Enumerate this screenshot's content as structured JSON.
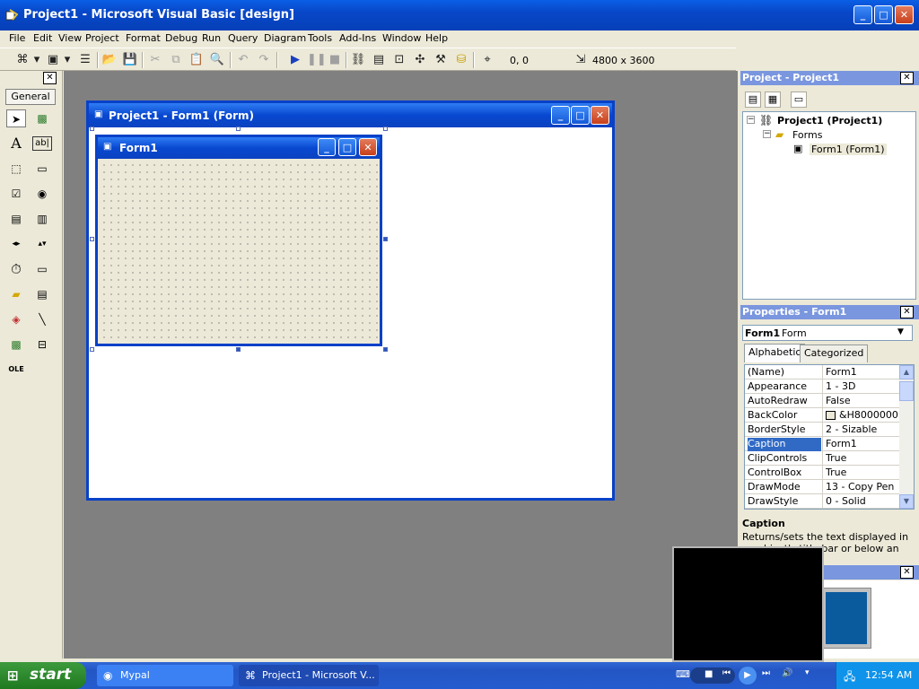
{
  "window": {
    "title": "Project1 - Microsoft Visual Basic [design]"
  },
  "menu": [
    "File",
    "Edit",
    "View",
    "Project",
    "Format",
    "Debug",
    "Run",
    "Query",
    "Diagram",
    "Tools",
    "Add-Ins",
    "Window",
    "Help"
  ],
  "toolbar": {
    "position": "0, 0",
    "size": "4800 x 3600"
  },
  "toolbox": {
    "tab_label": "General"
  },
  "designer": {
    "title": "Project1 - Form1 (Form)"
  },
  "form": {
    "title": "Form1"
  },
  "project_explorer": {
    "title": "Project - Project1",
    "root": "Project1 (Project1)",
    "folder": "Forms",
    "item": "Form1 (Form1)"
  },
  "properties": {
    "title": "Properties - Form1",
    "object_name": "Form1",
    "object_type": "Form",
    "tabs": [
      "Alphabetic",
      "Categorized"
    ],
    "rows": [
      {
        "name": "(Name)",
        "value": "Form1"
      },
      {
        "name": "Appearance",
        "value": "1 - 3D"
      },
      {
        "name": "AutoRedraw",
        "value": "False"
      },
      {
        "name": "BackColor",
        "value": "&H8000000F"
      },
      {
        "name": "BorderStyle",
        "value": "2 - Sizable"
      },
      {
        "name": "Caption",
        "value": "Form1"
      },
      {
        "name": "ClipControls",
        "value": "True"
      },
      {
        "name": "ControlBox",
        "value": "True"
      },
      {
        "name": "DrawMode",
        "value": "13 - Copy Pen"
      },
      {
        "name": "DrawStyle",
        "value": "0 - Solid"
      }
    ],
    "selected": "Caption",
    "description_title": "Caption",
    "description_text": "Returns/sets the text displayed in an object's title bar or below an object's"
  },
  "taskbar": {
    "start_label": "start",
    "tasks": [
      "Mypal",
      "Project1 - Microsoft V..."
    ],
    "clock": "12:54 AM"
  }
}
